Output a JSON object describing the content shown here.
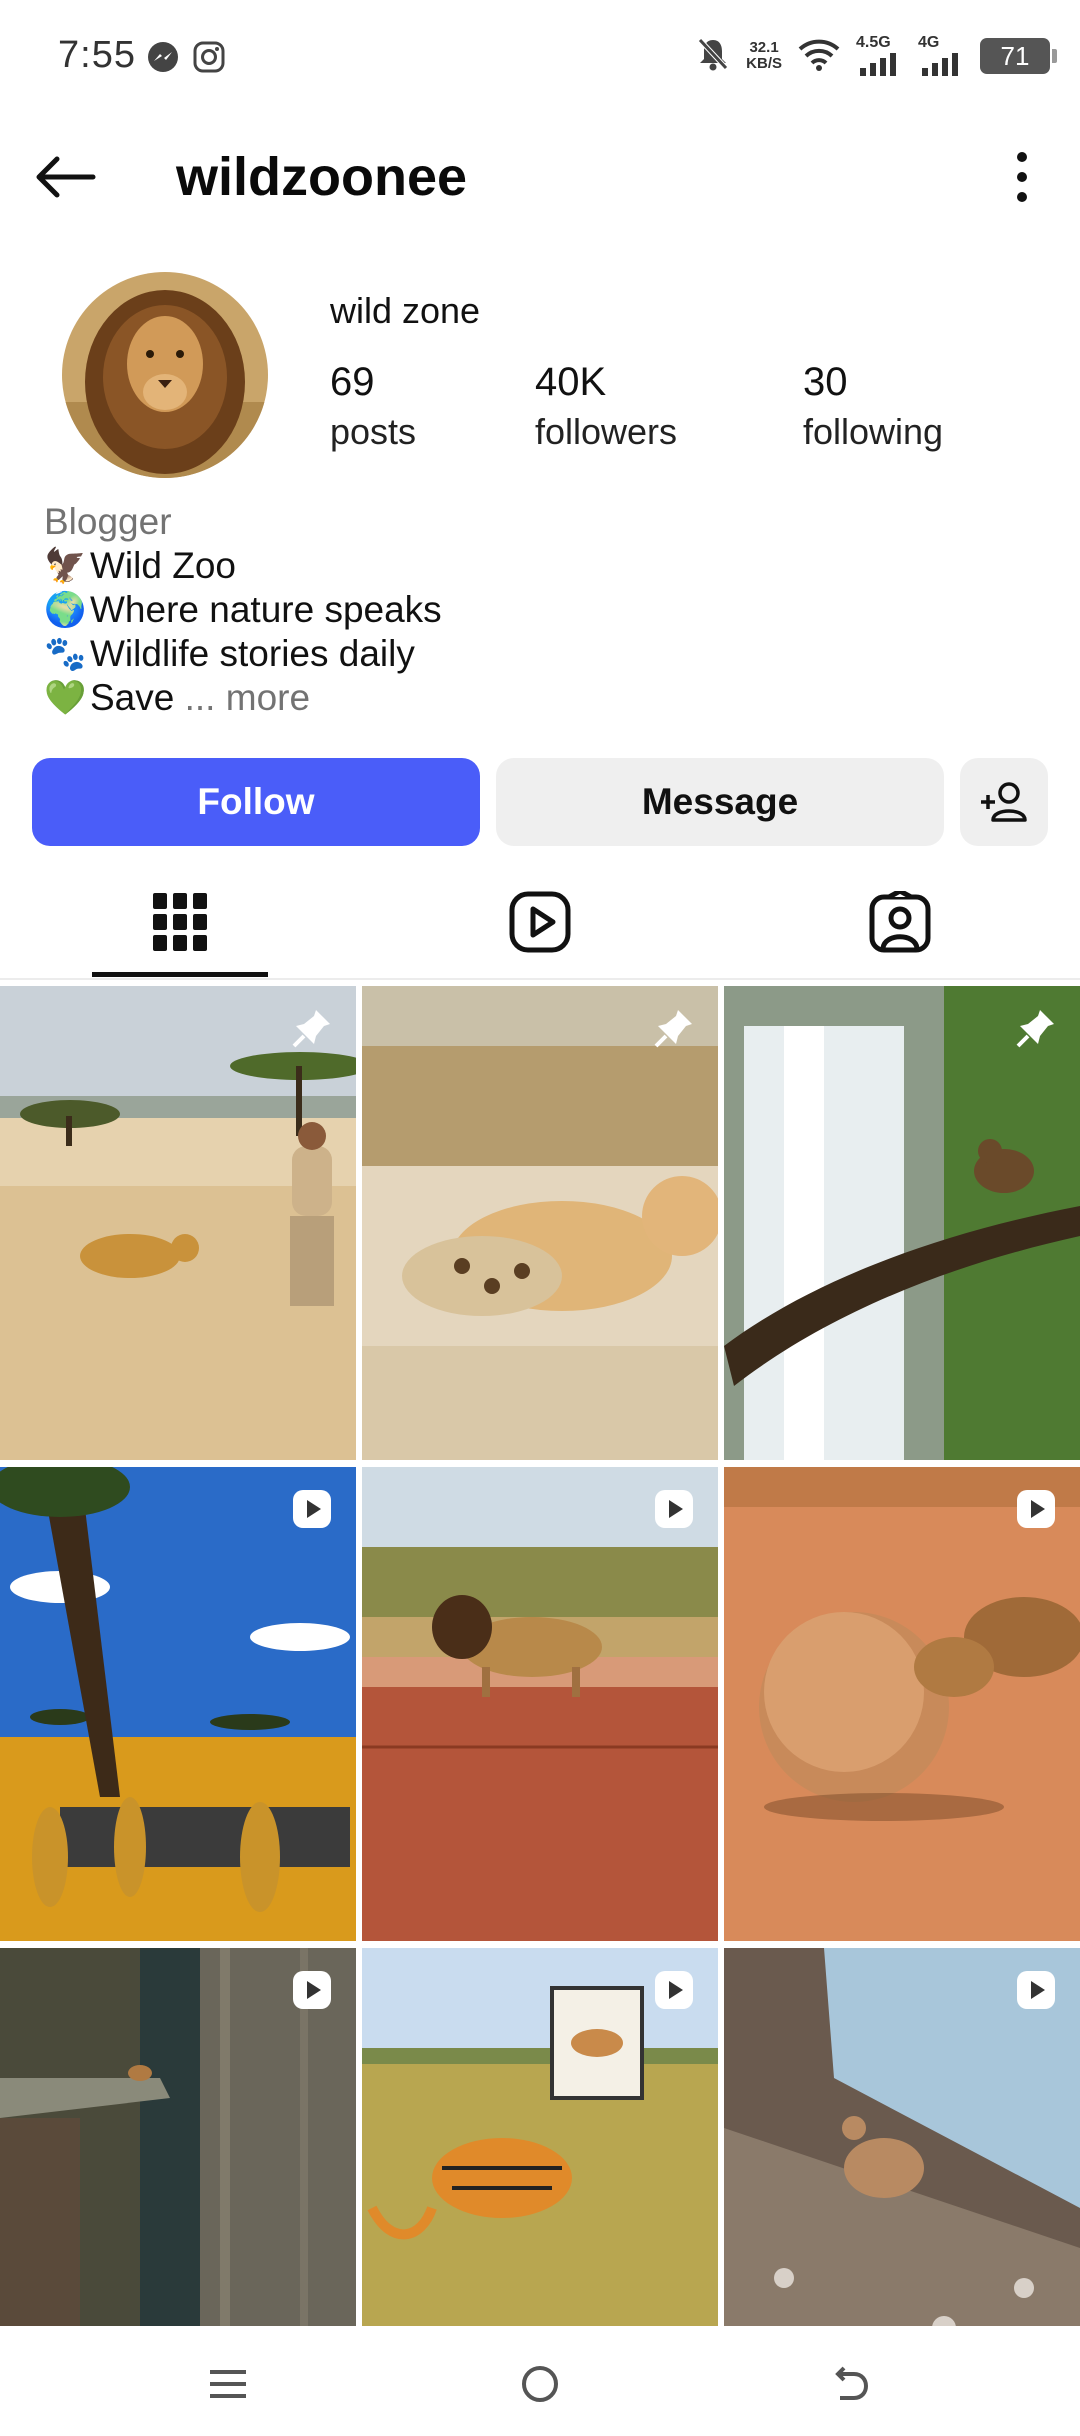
{
  "status_bar": {
    "time": "7:55",
    "speed_value": "32.1",
    "speed_unit": "KB/S",
    "net1": "4.5G",
    "net2": "4G",
    "battery": "71"
  },
  "header": {
    "username": "wildzoonee"
  },
  "profile": {
    "display_name": "wild zone",
    "stats": [
      {
        "value": "69",
        "label": "posts"
      },
      {
        "value": "40K",
        "label": "followers"
      },
      {
        "value": "30",
        "label": "following"
      }
    ],
    "category": "Blogger",
    "bio_lines": [
      {
        "emoji": "🦅",
        "text": "Wild Zoo"
      },
      {
        "emoji": "🌍",
        "text": "Where nature speaks"
      },
      {
        "emoji": "🐾",
        "text": "Wildlife stories daily"
      },
      {
        "emoji": "💚",
        "text": "Save"
      }
    ],
    "more_label": "... more"
  },
  "actions": {
    "follow_label": "Follow",
    "message_label": "Message"
  },
  "tabs": [
    {
      "icon": "grid-icon",
      "active": true
    },
    {
      "icon": "reels-icon",
      "active": false
    },
    {
      "icon": "tagged-icon",
      "active": false
    }
  ],
  "grid": [
    {
      "subject": "leopard and man in savanna",
      "badge": "pin-icon"
    },
    {
      "subject": "lioness fighting leopard",
      "badge": "pin-icon"
    },
    {
      "subject": "monkey on branch by waterfall",
      "badge": "pin-icon"
    },
    {
      "subject": "lions under tree with monkey",
      "badge": "reel-icon"
    },
    {
      "subject": "lion on rock ledge",
      "badge": "reel-icon"
    },
    {
      "subject": "animal pushing boulder",
      "badge": "reel-icon"
    },
    {
      "subject": "lion on cliff edge",
      "badge": "reel-icon"
    },
    {
      "subject": "tiger and antelope sign",
      "badge": "reel-icon"
    },
    {
      "subject": "goat on rocky slope",
      "badge": "reel-icon"
    }
  ],
  "colors": {
    "follow_button": "#4a5df9",
    "secondary_button": "#efefef",
    "muted_text": "#737373"
  }
}
